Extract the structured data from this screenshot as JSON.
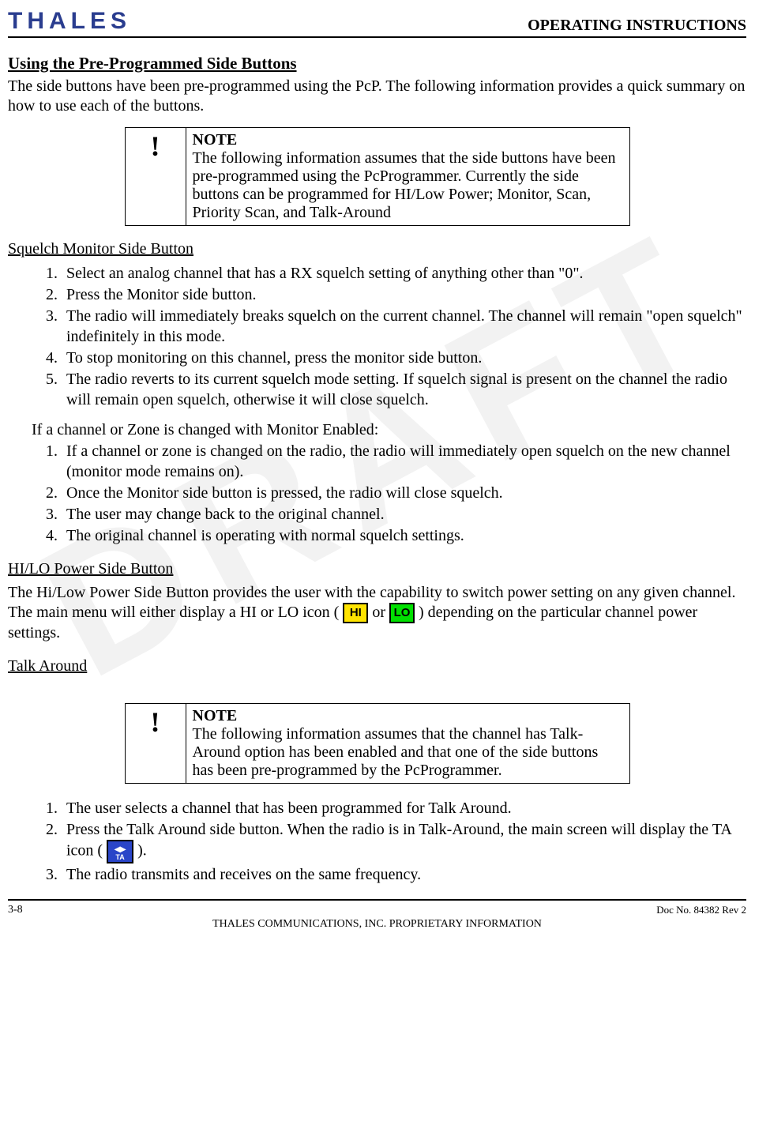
{
  "header": {
    "logo_text": "THALES",
    "title": "OPERATING INSTRUCTIONS"
  },
  "section": {
    "title": "Using the Pre-Programmed Side Buttons",
    "intro": "The side buttons have been pre-programmed using the PcP.  The following information provides a quick summary on how to use each of the buttons."
  },
  "note1": {
    "bang": "!",
    "label": "NOTE",
    "body": "The following information assumes that the side buttons have been pre-programmed using the PcProgrammer.  Currently the side buttons can be programmed for HI/Low Power; Monitor, Scan, Priority Scan, and Talk-Around"
  },
  "squelch": {
    "title": "Squelch Monitor Side Button",
    "list1": [
      "Select an analog channel that has a RX squelch setting of anything other than \"0\".",
      "Press the Monitor side button.",
      "The radio will immediately breaks squelch on the current channel.  The channel will remain \"open squelch\" indefinitely in this mode.",
      "To stop monitoring on this channel, press the monitor side button.",
      "The radio reverts to its current squelch mode setting.  If squelch signal is present on the channel the radio will remain open squelch, otherwise it will close squelch."
    ],
    "mid": "If a channel or Zone is changed with Monitor Enabled:",
    "list2": [
      "If a channel or zone is changed on the radio, the radio will immediately open squelch on the new channel (monitor mode remains on).",
      "Once the Monitor side button is pressed, the radio will close squelch.",
      "The user may change back to the original channel.",
      "The original channel is operating with normal squelch settings."
    ]
  },
  "hilo": {
    "title": "HI/LO Power Side Button",
    "pre": "The Hi/Low Power Side Button provides the user with the capability to switch power setting on any given channel.   The main menu will either display a HI or LO icon (",
    "or": " or  ",
    "post": ") depending on the particular channel power settings.",
    "hi": "HI",
    "lo": "LO"
  },
  "ta": {
    "title": "Talk Around",
    "note_bang": "!",
    "note_label": "NOTE",
    "note_body": "The following information assumes that the channel has Talk-Around option has been enabled and that one of the side buttons has been pre-programmed by the PcProgrammer.",
    "l1": "The user selects a channel that has been programmed for Talk Around.",
    "l2a": "Press the Talk Around side button.  When the radio is in Talk-Around, the main screen will display the TA icon (",
    "l2b": ").",
    "l3": "The radio transmits and receives on the same frequency.",
    "ta_label": "TA"
  },
  "footer": {
    "page": "3-8",
    "doc": "Doc No. 84382 Rev 2",
    "proprietary": "THALES COMMUNICATIONS, INC. PROPRIETARY INFORMATION"
  }
}
